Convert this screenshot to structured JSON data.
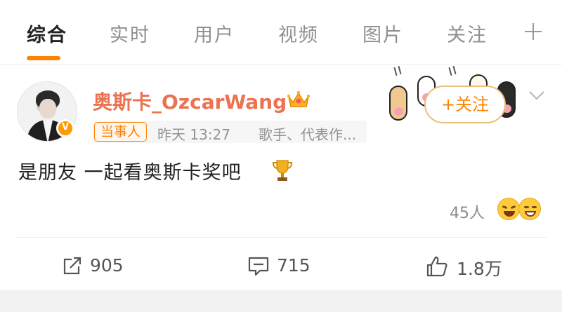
{
  "tabs": [
    {
      "label": "综合",
      "active": true
    },
    {
      "label": "实时",
      "active": false
    },
    {
      "label": "用户",
      "active": false
    },
    {
      "label": "视频",
      "active": false
    },
    {
      "label": "图片",
      "active": false
    },
    {
      "label": "关注",
      "active": false
    }
  ],
  "tab_add_icon": "plus-icon",
  "accent_color": "#ff8200",
  "username_color": "#eb7350",
  "post": {
    "author": "奥斯卡_OzcarWang",
    "author_badge_icon": "crown-icon",
    "verified_icon": "verified-v-icon",
    "tag": "当事人",
    "time": "昨天 13:27",
    "description": "歌手、代表作...",
    "follow_label": "+关注",
    "text": "是朋友  一起看奥斯卡奖吧",
    "text_emoji": "trophy-icon",
    "reaction_count": "45人",
    "reaction_icons": [
      "laughing-emoji-icon",
      "grinning-emoji-icon"
    ]
  },
  "actions": {
    "repost": {
      "icon": "share-icon",
      "count": "905"
    },
    "comment": {
      "icon": "comment-icon",
      "count": "715"
    },
    "like": {
      "icon": "thumb-up-icon",
      "count": "1.8万"
    }
  }
}
